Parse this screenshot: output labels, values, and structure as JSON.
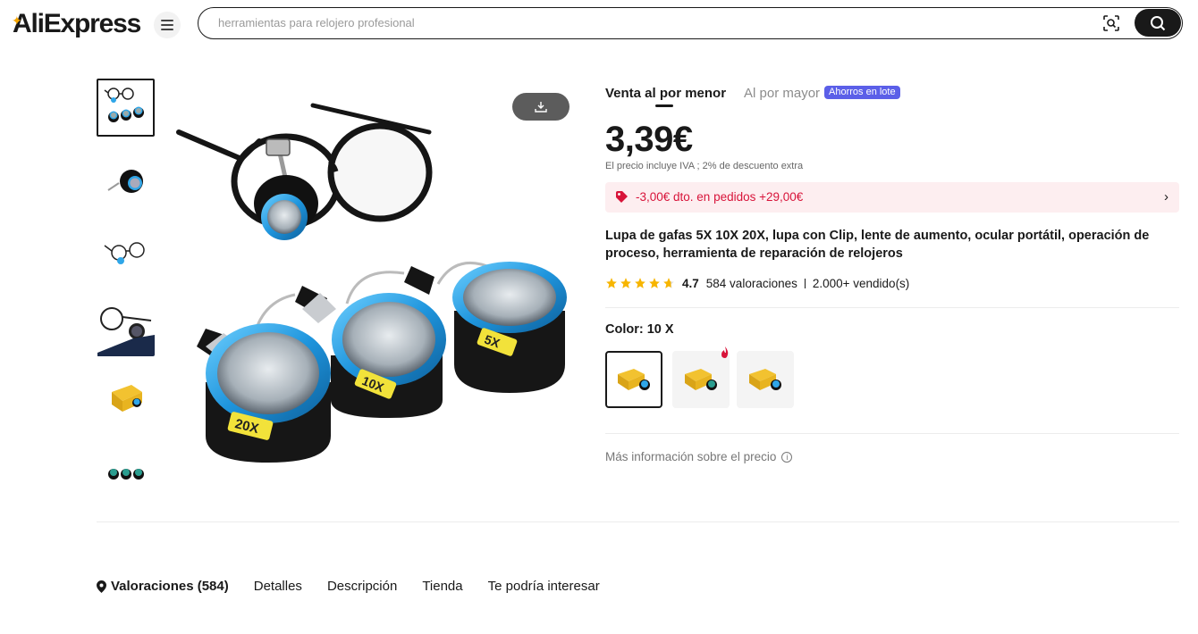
{
  "header": {
    "logo": "AliExpress",
    "search_placeholder": "herramientas para relojero profesional"
  },
  "product": {
    "tabs": {
      "retail": "Venta al por menor",
      "wholesale": "Al por mayor",
      "wholesale_badge": "Ahorros en lote"
    },
    "price": "3,39€",
    "price_note": "El precio incluye IVA ; 2% de descuento extra",
    "coupon": "-3,00€ dto. en pedidos +29,00€",
    "title": "Lupa de gafas 5X 10X 20X, lupa con Clip, lente de aumento, ocular portátil, operación de proceso, herramienta de reparación de relojeros",
    "rating": "4.7",
    "reviews": "584 valoraciones",
    "sold": "2.000+ vendido(s)",
    "color_label": "Color: 10 X",
    "more_info": "Más información sobre el precio",
    "lens_labels": [
      "20X",
      "10X",
      "5X"
    ]
  },
  "bottom_tabs": {
    "reviews": "Valoraciones (584)",
    "details": "Detalles",
    "description": "Descripción",
    "store": "Tienda",
    "recommended": "Te podría interesar"
  },
  "colors": {
    "accent_blue": "#2fa6e8",
    "coupon_red": "#d8143a",
    "badge_purple": "#5b5fe8",
    "star_yellow": "#f7b500"
  }
}
